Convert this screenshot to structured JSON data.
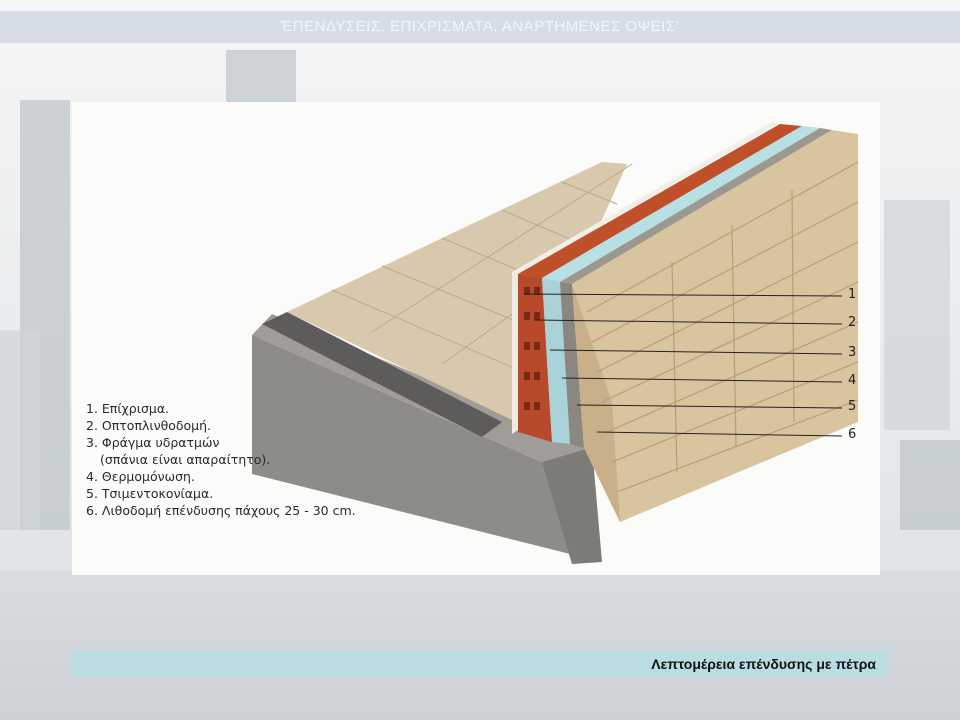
{
  "slide": {
    "title": "ΈΠΕΝΔΥΣΕΙΣ, ΕΠΙΧΡΙΣΜΑΤΑ, ΑΝΑΡΤΗΜΕΝΕΣ ΟΨΕΙΣ’",
    "caption": "Λεπτομέρεια επένδυσης με πέτρα"
  },
  "diagram": {
    "callout_numbers": [
      "1",
      "2",
      "3",
      "4",
      "5",
      "6"
    ],
    "legend": [
      "1. Επίχρισμα.",
      "2. Οπτοπλινθοδομή.",
      "3. Φράγμα υδρατμών",
      "(σπάνια είναι απαραίτητο).",
      "4. Θερμομόνωση.",
      "5. Τσιμεντοκονίαμα.",
      "6. Λιθοδομή επένδυσης πάχους 25 - 30 cm."
    ]
  },
  "colors": {
    "title_bar": "#d6dde8",
    "caption_bar": "#b9dde3",
    "brick": "#c0502a",
    "insulation": "#a9d3d8",
    "stone": "#d9c4a0",
    "concrete": "#8a8885"
  }
}
